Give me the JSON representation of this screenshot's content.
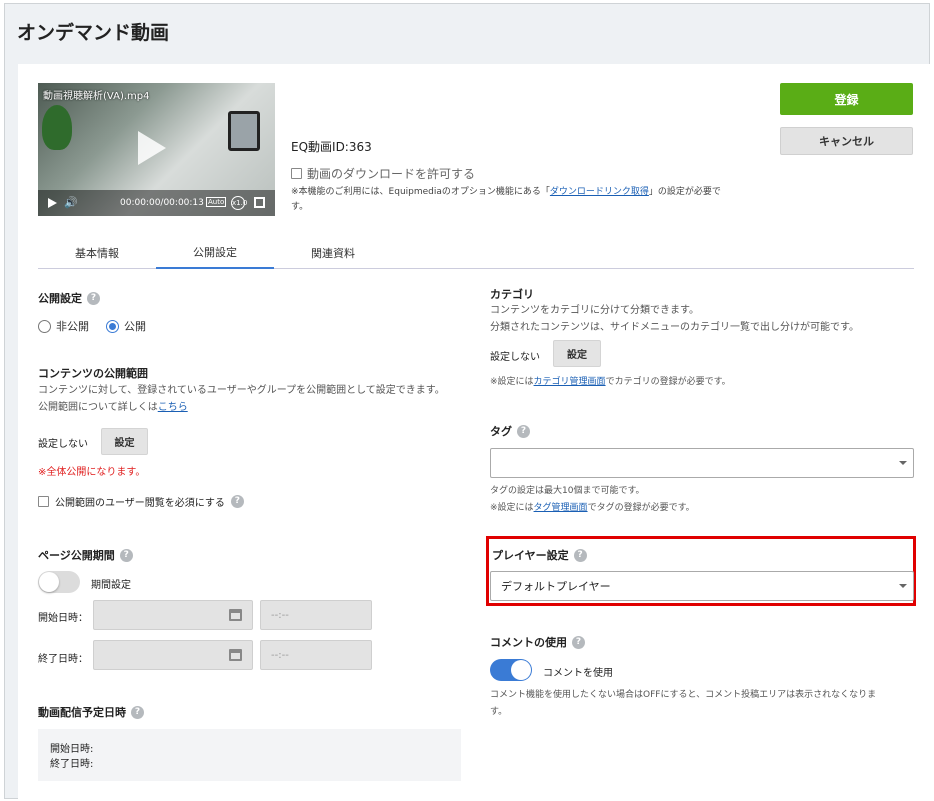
{
  "page": {
    "title": "オンデマンド動画"
  },
  "video": {
    "filename": "動画視聴解析(VA).mp4",
    "time": "00:00:00/00:00:13",
    "auto_label": "Auto",
    "speed_label": "x1.0"
  },
  "header": {
    "eq_id": "EQ動画ID:363",
    "download_label": "動画のダウンロードを許可する",
    "note_prefix": "※本機能のご利用には、Equipmediaのオプション機能にある「",
    "note_link": "ダウンロードリンク取得",
    "note_suffix": "」の設定が必要で",
    "note_line2": "す。",
    "register_label": "登録",
    "cancel_label": "キャンセル"
  },
  "tabs": [
    {
      "label": "基本情報",
      "active": false
    },
    {
      "label": "公開設定",
      "active": true
    },
    {
      "label": "関連資料",
      "active": false
    }
  ],
  "left": {
    "publish_heading": "公開設定",
    "radio_private": "非公開",
    "radio_public": "公開",
    "radio_selected": "公開",
    "scope_heading": "コンテンツの公開範囲",
    "scope_desc1": "コンテンツに対して、登録されているユーザーやグループを公開範囲として設定できます。",
    "scope_desc2_prefix": "公開範囲について詳しくは",
    "scope_desc2_link": "こちら",
    "scope_value": "設定しない",
    "scope_btn": "設定",
    "scope_warning": "※全体公開になります。",
    "scope_required_label": "公開範囲のユーザー閲覧を必須にする",
    "period_heading": "ページ公開期間",
    "period_toggle_label": "期間設定",
    "period_enabled": false,
    "start_label": "開始日時：",
    "end_label": "終了日時：",
    "time_placeholder": "--:--",
    "schedule_heading": "動画配信予定日時",
    "schedule_start": "開始日時:",
    "schedule_end": "終了日時:"
  },
  "right": {
    "category_heading": "カテゴリ",
    "category_desc1": "コンテンツをカテゴリに分けて分類できます。",
    "category_desc2": "分類されたコンテンツは、サイドメニューのカテゴリ一覧で出し分けが可能です。",
    "category_value": "設定しない",
    "category_btn": "設定",
    "category_note_prefix": "※設定には",
    "category_note_link": "カテゴリ管理画面",
    "category_note_suffix": "でカテゴリの登録が必要です。",
    "tag_heading": "タグ",
    "tag_value": "",
    "tag_note1": "タグの設定は最大10個まで可能です。",
    "tag_note2_prefix": "※設定には",
    "tag_note2_link": "タグ管理画面",
    "tag_note2_suffix": "でタグの登録が必要です。",
    "player_heading": "プレイヤー設定",
    "player_value": "デフォルトプレイヤー",
    "comment_heading": "コメントの使用",
    "comment_toggle_label": "コメントを使用",
    "comment_enabled": true,
    "comment_note1": "コメント機能を使用したくない場合はOFFにすると、コメント投稿エリアは表示されなくなりま",
    "comment_note2": "す。"
  },
  "colors": {
    "accent": "#3a7bd5",
    "register": "#5aad16",
    "highlight": "#e00000",
    "warning": "#e02020"
  }
}
